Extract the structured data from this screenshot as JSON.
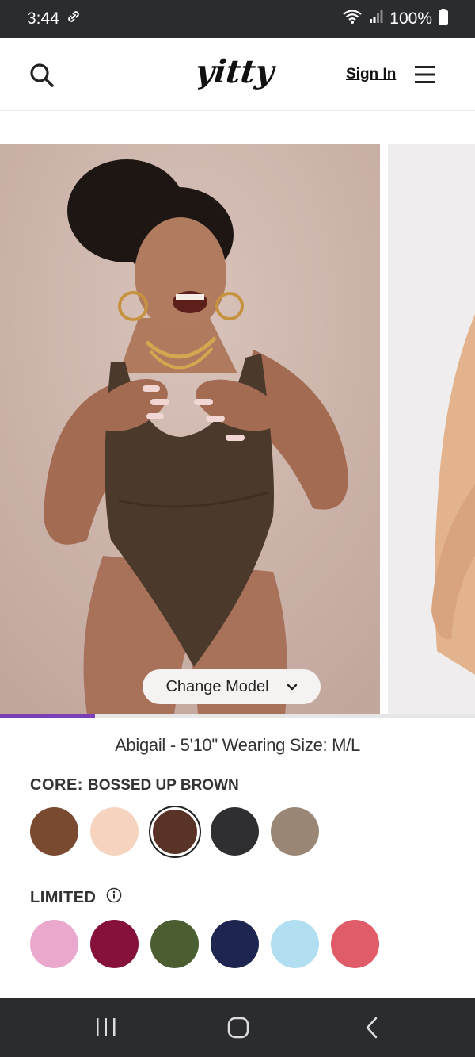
{
  "status_bar": {
    "time": "3:44",
    "battery": "100%"
  },
  "header": {
    "logo_text": "yitty",
    "sign_in_label": "Sign In"
  },
  "gallery": {
    "change_model_label": "Change Model",
    "progress": 0.2
  },
  "model_caption": "Abigail - 5'10\" Wearing Size: M/L",
  "core": {
    "heading": "CORE:",
    "selected_color": "BOSSED UP BROWN",
    "swatches": [
      "#7a4a30",
      "#f6d3be",
      "#5a3327",
      "#2f2f31",
      "#9a8674"
    ],
    "selected_index": 2
  },
  "limited": {
    "heading": "LIMITED",
    "swatches": [
      "#eba8cd",
      "#85113a",
      "#4a5e32",
      "#1d2550",
      "#b2def1",
      "#e05c69"
    ]
  }
}
